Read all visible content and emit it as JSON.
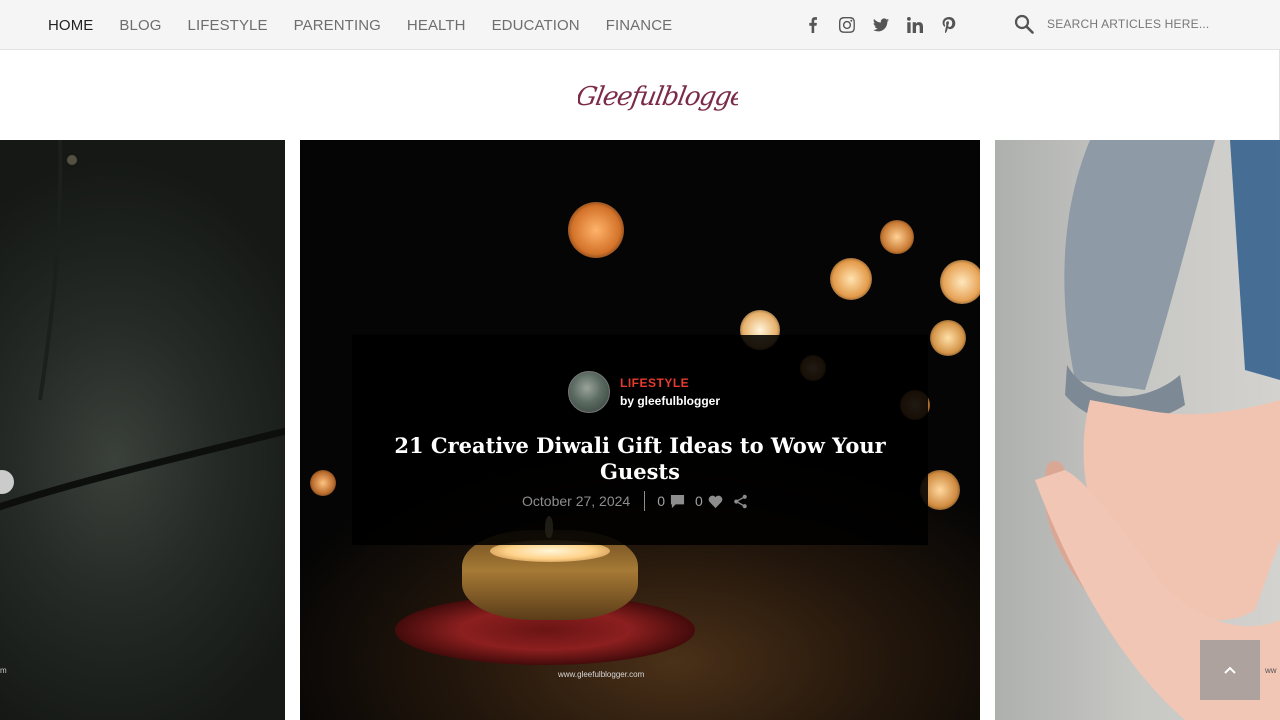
{
  "nav": {
    "items": [
      {
        "label": "HOME",
        "active": true
      },
      {
        "label": "BLOG"
      },
      {
        "label": "LIFESTYLE"
      },
      {
        "label": "PARENTING"
      },
      {
        "label": "HEALTH"
      },
      {
        "label": "EDUCATION"
      },
      {
        "label": "FINANCE"
      }
    ]
  },
  "social": [
    "facebook-icon",
    "instagram-icon",
    "twitter-icon",
    "linkedin-icon",
    "pinterest-icon"
  ],
  "search": {
    "placeholder": "SEARCH ARTICLES HERE..."
  },
  "logo": {
    "text": "Gleefulblogger",
    "color": "#7b2a48"
  },
  "featured_post": {
    "category": "LIFESTYLE",
    "author": "by gleefulblogger",
    "title": "21 Creative Diwali Gift Ideas to Wow Your Guests",
    "date": "October 27, 2024",
    "comments": "0",
    "likes": "0",
    "watermark": "www.gleefulblogger.com",
    "category_color": "#e63b2e"
  },
  "side_slides": {
    "left_watermark": "m",
    "right_watermark": "ww"
  }
}
